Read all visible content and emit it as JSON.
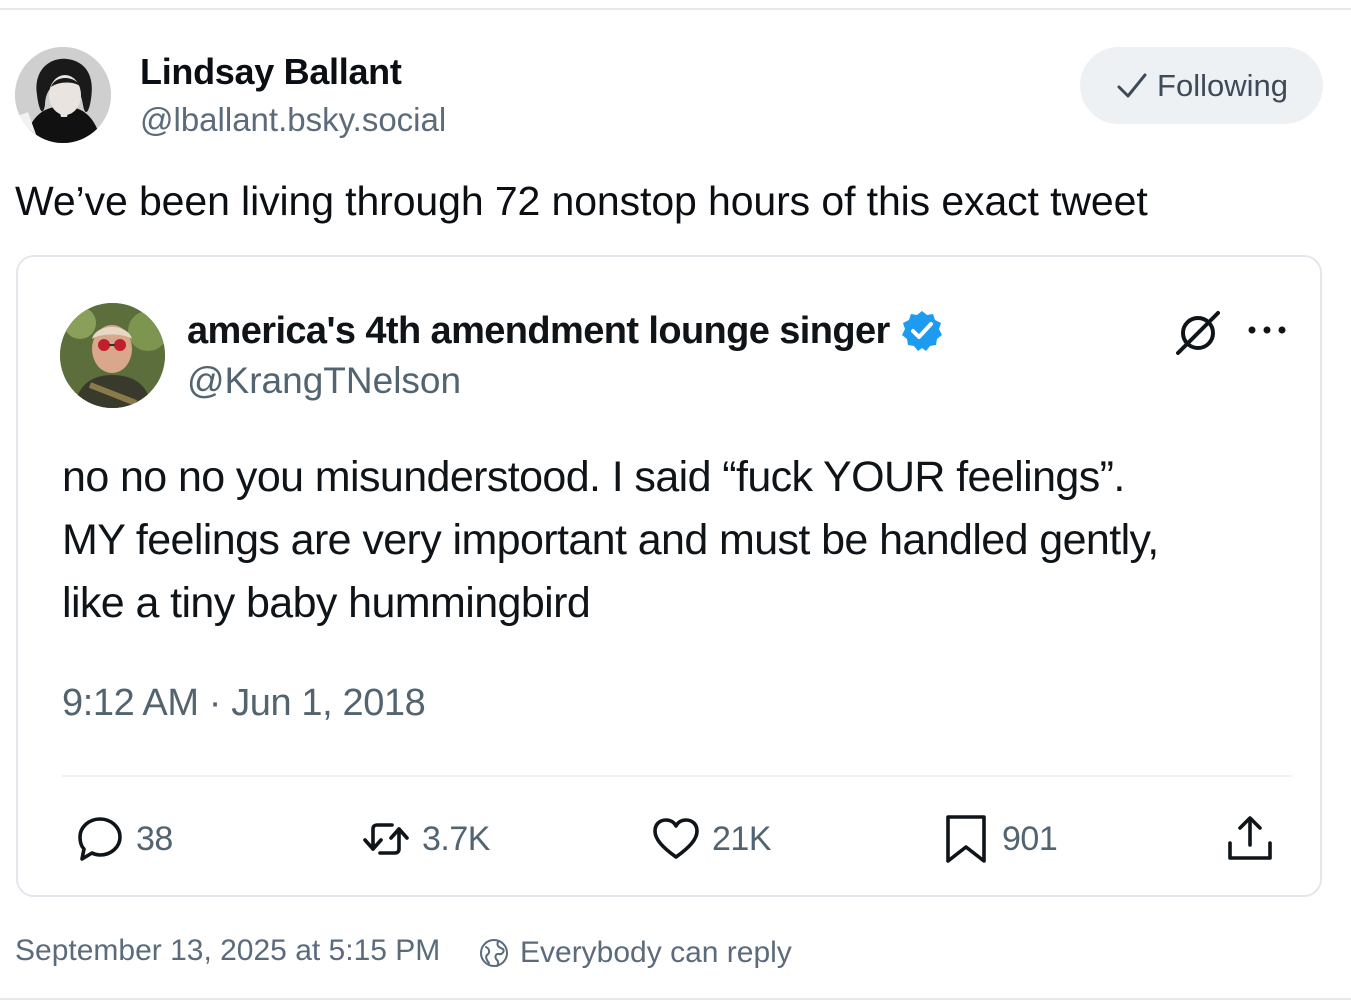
{
  "post": {
    "author_name": "Lindsay Ballant",
    "author_handle": "@lballant.bsky.social",
    "follow_label": "Following",
    "text": "We’ve been living through 72 nonstop hours of this exact tweet",
    "date": "September 13, 2025 at 5:15 PM",
    "reply_setting": "Everybody can reply"
  },
  "quote": {
    "name": "america's 4th amendment lounge singer",
    "handle": "@KrangTNelson",
    "verified": true,
    "body_lines": [
      "no no no you misunderstood. I said “fuck YOUR feelings”.",
      "MY feelings are very important and must be handled gently,",
      "like a tiny baby hummingbird"
    ],
    "timestamp": "9:12 AM · Jun 1, 2018",
    "stats": {
      "replies": "38",
      "reposts": "3.7K",
      "likes": "21K",
      "bookmarks": "901"
    }
  },
  "icons": {
    "follow": "check-icon",
    "verified": "verified-badge-icon",
    "quote_logo": "cancel-logo-icon",
    "more": "more-icon",
    "reply": "reply-icon",
    "repost": "repost-icon",
    "like": "heart-icon",
    "bookmark": "bookmark-icon",
    "share": "share-icon",
    "reply_setting": "globe-icon"
  },
  "colors": {
    "verified_blue": "#1d9bf0",
    "muted_text": "#536471",
    "follow_bg": "#eef1f4"
  }
}
